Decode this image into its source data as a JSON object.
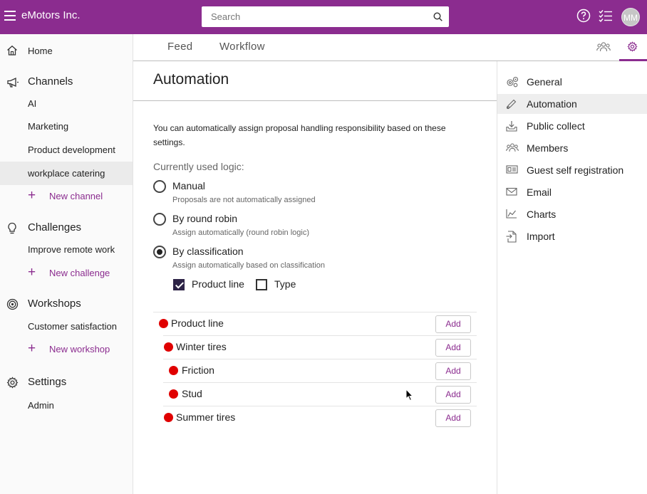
{
  "header": {
    "app_title": "eMotors Inc.",
    "search_placeholder": "Search",
    "avatar_initials": "MM",
    "accent_color": "#8b2c8f"
  },
  "sidebar": {
    "home": "Home",
    "channels": {
      "title": "Channels",
      "items": [
        "AI",
        "Marketing",
        "Product development",
        "workplace catering"
      ],
      "selected": "workplace catering",
      "new_label": "New channel"
    },
    "challenges": {
      "title": "Challenges",
      "items": [
        "Improve remote work"
      ],
      "new_label": "New challenge"
    },
    "workshops": {
      "title": "Workshops",
      "items": [
        "Customer satisfaction"
      ],
      "new_label": "New workshop"
    },
    "settings": {
      "title": "Settings",
      "items": [
        "Admin"
      ]
    }
  },
  "tabs": {
    "feed": "Feed",
    "workflow": "Workflow"
  },
  "automation": {
    "title": "Automation",
    "description": "You can automatically assign proposal handling responsibility based on these settings.",
    "logic_label": "Currently used logic:",
    "options": [
      {
        "label": "Manual",
        "hint": "Proposals are not automatically assigned",
        "checked": false
      },
      {
        "label": "By round robin",
        "hint": "Assign automatically (round robin logic)",
        "checked": false
      },
      {
        "label": "By classification",
        "hint": "Assign automatically based on classification",
        "checked": true
      }
    ],
    "classification_checkboxes": [
      {
        "label": "Product line",
        "checked": true
      },
      {
        "label": "Type",
        "checked": false
      }
    ],
    "tree": [
      {
        "label": "Product line",
        "level": 0,
        "button": "Add"
      },
      {
        "label": "Winter tires",
        "level": 1,
        "button": "Add"
      },
      {
        "label": "Friction",
        "level": 2,
        "button": "Add"
      },
      {
        "label": "Stud",
        "level": 2,
        "button": "Add"
      },
      {
        "label": "Summer tires",
        "level": 1,
        "button": "Add"
      }
    ],
    "status_dot_color": "#e00000"
  },
  "settings_menu": {
    "items": [
      {
        "label": "General",
        "icon": "gears-icon"
      },
      {
        "label": "Automation",
        "icon": "pen-icon"
      },
      {
        "label": "Public collect",
        "icon": "tray-download-icon"
      },
      {
        "label": "Members",
        "icon": "members-icon"
      },
      {
        "label": "Guest self registration",
        "icon": "id-card-icon"
      },
      {
        "label": "Email",
        "icon": "envelope-icon"
      },
      {
        "label": "Charts",
        "icon": "chart-icon"
      },
      {
        "label": "Import",
        "icon": "import-file-icon"
      }
    ],
    "active": "Automation"
  }
}
